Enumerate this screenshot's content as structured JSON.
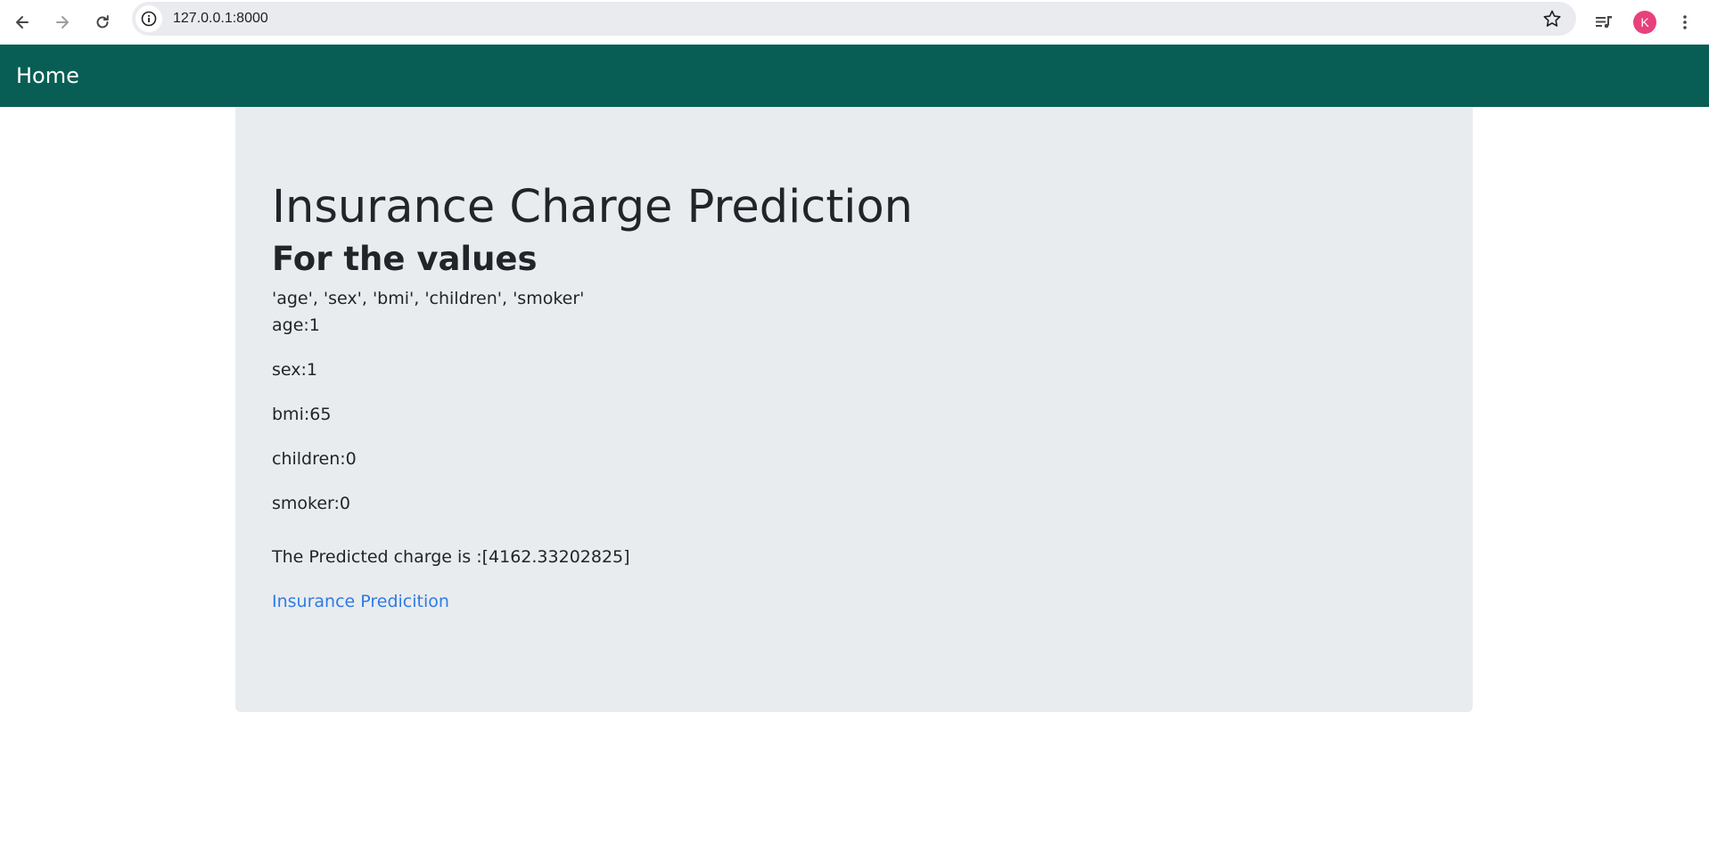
{
  "browser": {
    "url": "127.0.0.1:8000",
    "profile_initial": "K",
    "profile_color": "#e8407d"
  },
  "navbar": {
    "brand": "Home",
    "background": "#085e55"
  },
  "main": {
    "title": "Insurance Charge Prediction",
    "subtitle": "For the values",
    "fields_line": "'age', 'sex', 'bmi', 'children', 'smoker'",
    "values": [
      {
        "text": "age:1"
      },
      {
        "text": "sex:1"
      },
      {
        "text": "bmi:65"
      },
      {
        "text": "children:0"
      },
      {
        "text": "smoker:0"
      }
    ],
    "result": "The Predicted charge is :[4162.33202825]",
    "link_label": "Insurance Predicition",
    "link_color": "#2f7ae5"
  }
}
